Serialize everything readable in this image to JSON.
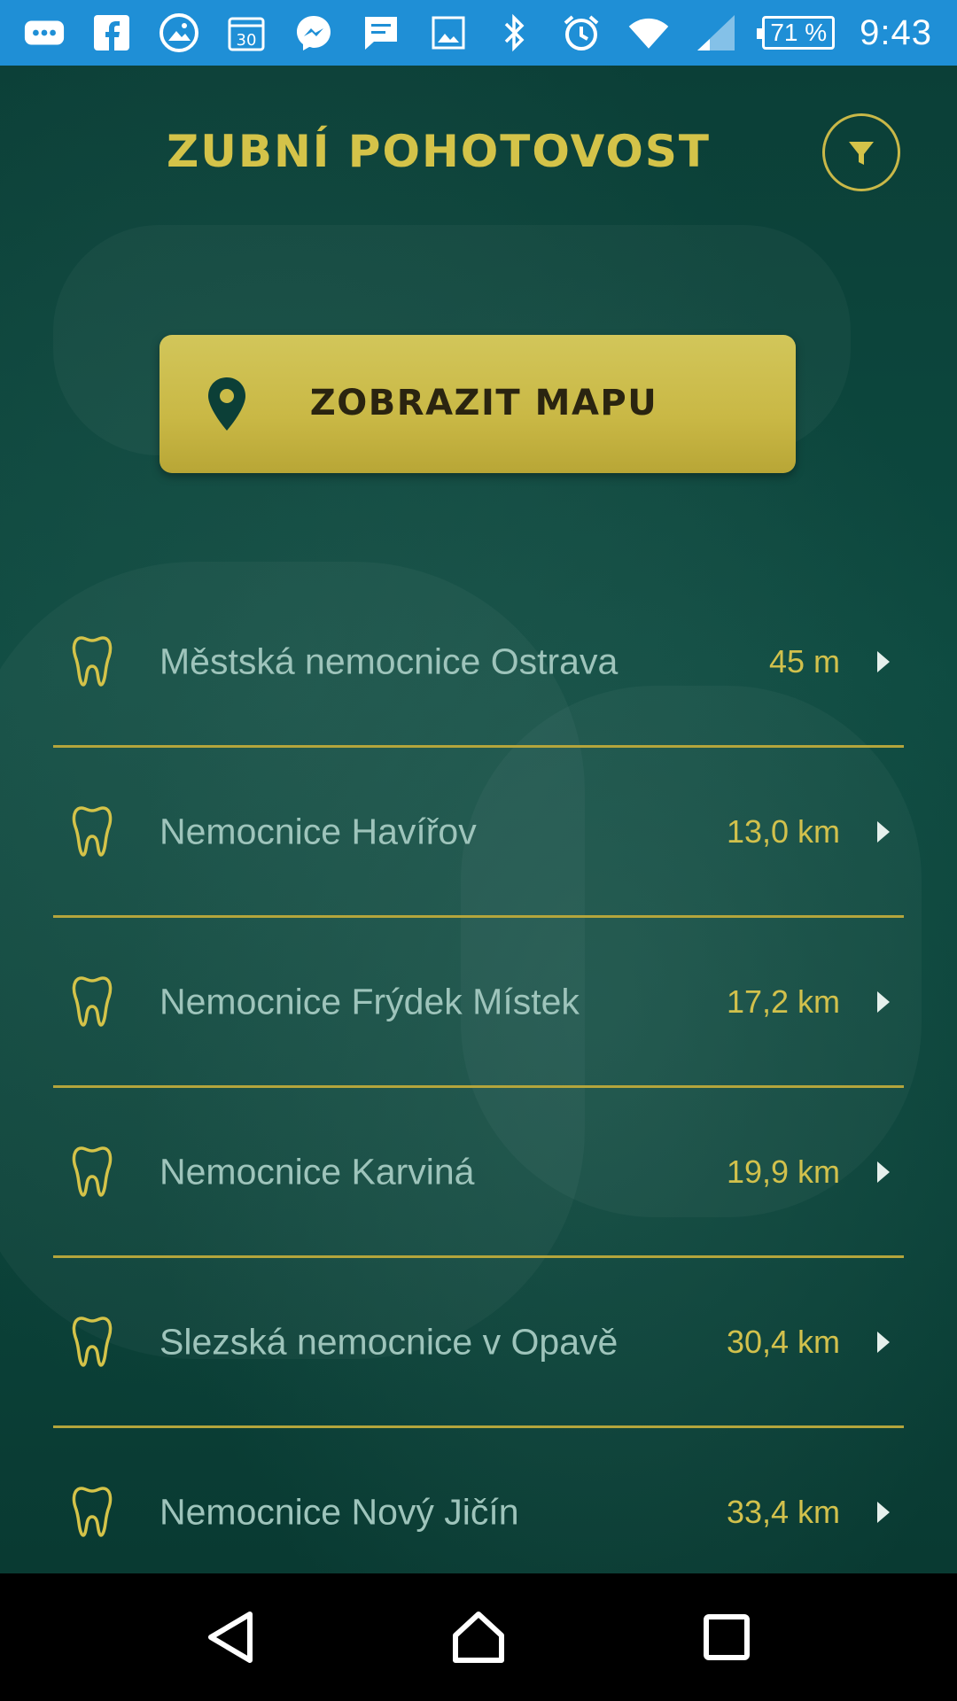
{
  "status_bar": {
    "icons_left": [
      "more-icon",
      "facebook-icon",
      "photos-icon",
      "calendar-icon",
      "messenger-icon",
      "message-icon",
      "image-icon"
    ],
    "icons_right": [
      "bluetooth-icon",
      "alarm-icon",
      "wifi-icon",
      "signal-icon"
    ],
    "battery": "71 %",
    "time": "9:43",
    "calendar_day": "30"
  },
  "header": {
    "title": "ZUBNÍ POHOTOVOST",
    "filter_icon": "filter-icon"
  },
  "map_button": {
    "label": "ZOBRAZIT MAPU",
    "icon": "location-pin-icon"
  },
  "hospitals": [
    {
      "name": "Městská nemocnice Ostrava",
      "distance": "45 m"
    },
    {
      "name": "Nemocnice Havířov",
      "distance": "13,0 km"
    },
    {
      "name": "Nemocnice Frýdek Místek",
      "distance": "17,2 km"
    },
    {
      "name": "Nemocnice Karviná",
      "distance": "19,9 km"
    },
    {
      "name": "Slezská nemocnice v Opavě",
      "distance": "30,4 km"
    },
    {
      "name": "Nemocnice Nový Jičín",
      "distance": "33,4 km"
    }
  ],
  "colors": {
    "status_bar": "#1f8fd6",
    "background": "#0b4239",
    "accent_gold": "#d4c349",
    "list_text": "#9ec4bb"
  },
  "nav_bar": {
    "buttons": [
      "back-icon",
      "home-icon",
      "recents-icon"
    ]
  }
}
